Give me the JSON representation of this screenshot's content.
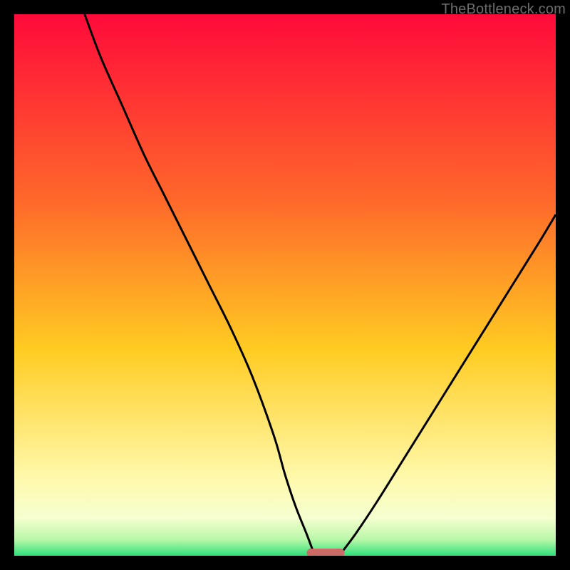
{
  "attribution": "TheBottleneck.com",
  "colors": {
    "frame_bg": "#000000",
    "gradient_top": "#ff0a3a",
    "gradient_mid_upper": "#ff6a2a",
    "gradient_mid": "#ffcc22",
    "gradient_lower": "#fff8a8",
    "gradient_bottom": "#2fe07a",
    "curve": "#000000",
    "marker": "#cc6a66"
  },
  "chart_data": {
    "type": "line",
    "title": "",
    "xlabel": "",
    "ylabel": "",
    "xlim": [
      0,
      100
    ],
    "ylim": [
      0,
      100
    ],
    "grid": false,
    "legend": false,
    "annotations": [],
    "series": [
      {
        "name": "left-branch",
        "x": [
          13,
          16,
          20,
          24,
          28,
          32,
          36,
          40,
          44,
          48,
          50,
          52,
          54,
          55.5
        ],
        "y": [
          100,
          92,
          83,
          74,
          66,
          58,
          50,
          42,
          33,
          22,
          15,
          9,
          4,
          0
        ]
      },
      {
        "name": "right-branch",
        "x": [
          60,
          63,
          67,
          72,
          77,
          82,
          87,
          92,
          97,
          100
        ],
        "y": [
          0,
          4,
          10,
          18,
          26,
          34,
          42,
          50,
          58,
          63
        ]
      }
    ],
    "marker": {
      "name": "optimal-zone",
      "shape": "rounded-bar",
      "x_range": [
        54,
        61
      ],
      "y": 0
    },
    "gradient_stops_pct": [
      0,
      35,
      62,
      85,
      93,
      97,
      100
    ]
  }
}
